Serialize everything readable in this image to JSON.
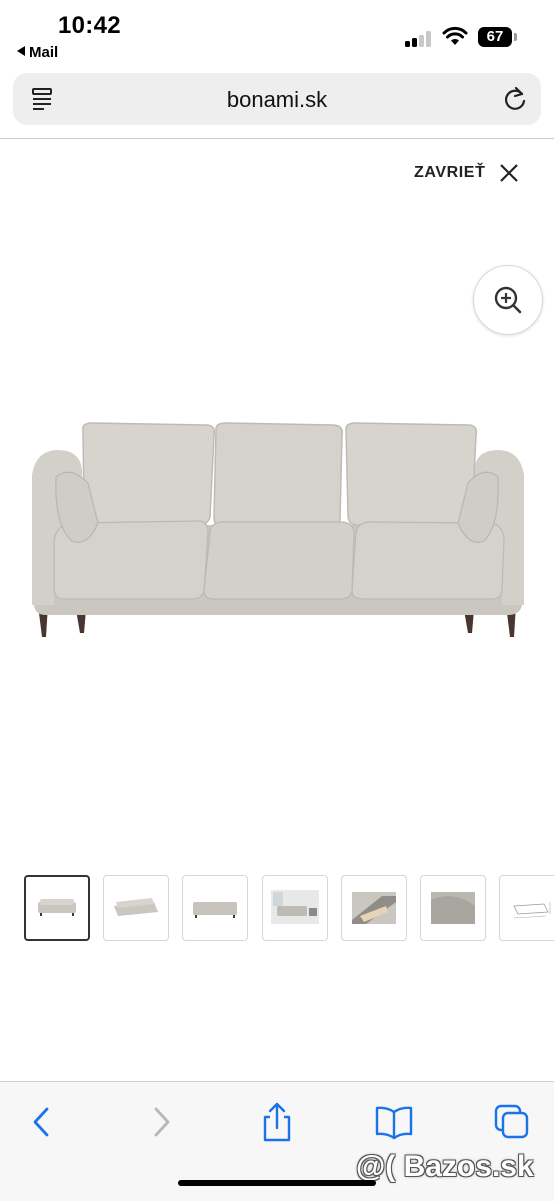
{
  "status_bar": {
    "time": "10:42",
    "back_app": "Mail",
    "battery": "67"
  },
  "browser": {
    "url": "bonami.sk",
    "icons": {
      "tabs": "tab-overview-icon",
      "reload": "reload-icon"
    }
  },
  "gallery": {
    "close_label": "ZAVRIEŤ",
    "icons": {
      "close": "close-icon",
      "zoom": "zoom-in-icon"
    },
    "sofa_color": "#d3d1cb",
    "thumbnails": [
      {
        "name": "thumb-sofa-front",
        "active": true
      },
      {
        "name": "thumb-sofa-angle",
        "active": false
      },
      {
        "name": "thumb-sofa-back",
        "active": false
      },
      {
        "name": "thumb-room-scene",
        "active": false
      },
      {
        "name": "thumb-fabric-detail",
        "active": false
      },
      {
        "name": "thumb-cushion-detail",
        "active": false
      },
      {
        "name": "thumb-dimensions",
        "active": false
      }
    ]
  },
  "toolbar": {
    "icons": [
      "back-icon",
      "forward-icon",
      "share-icon",
      "bookmarks-icon",
      "tabs-icon"
    ],
    "accent": "#1a73e8"
  },
  "watermark": "@( Bazos.sk"
}
